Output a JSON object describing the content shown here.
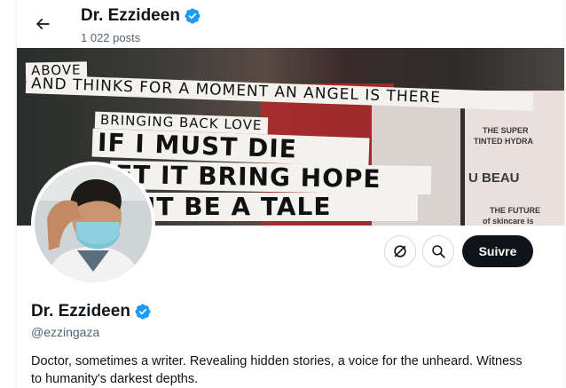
{
  "header": {
    "name": "Dr. Ezzideen",
    "posts_count": "1 022 posts"
  },
  "banner": {
    "strips": [
      "ABOVE",
      "AND THINKS FOR A MOMENT AN ANGEL IS THERE",
      "BRINGING BACK LOVE",
      "IF I MUST DIE",
      "ET IT BRING HOPE",
      "IT BE A TALE"
    ],
    "ad_text": [
      "THE SUPER",
      "TINTED HYDRA",
      "U BEAU",
      "THE FUTURE",
      "of skincare is"
    ]
  },
  "actions": {
    "follow_label": "Suivre",
    "grok_icon": "grok-icon",
    "search_icon": "search-icon"
  },
  "profile": {
    "name": "Dr. Ezzideen",
    "handle": "@ezzingaza",
    "bio": "Doctor, sometimes a writer. Revealing hidden stories, a voice for the unheard. Witness to humanity's darkest depths."
  },
  "colors": {
    "verified_badge": "#1d9bf0",
    "follow_button_bg": "#0f1419",
    "secondary_text": "#536471"
  }
}
